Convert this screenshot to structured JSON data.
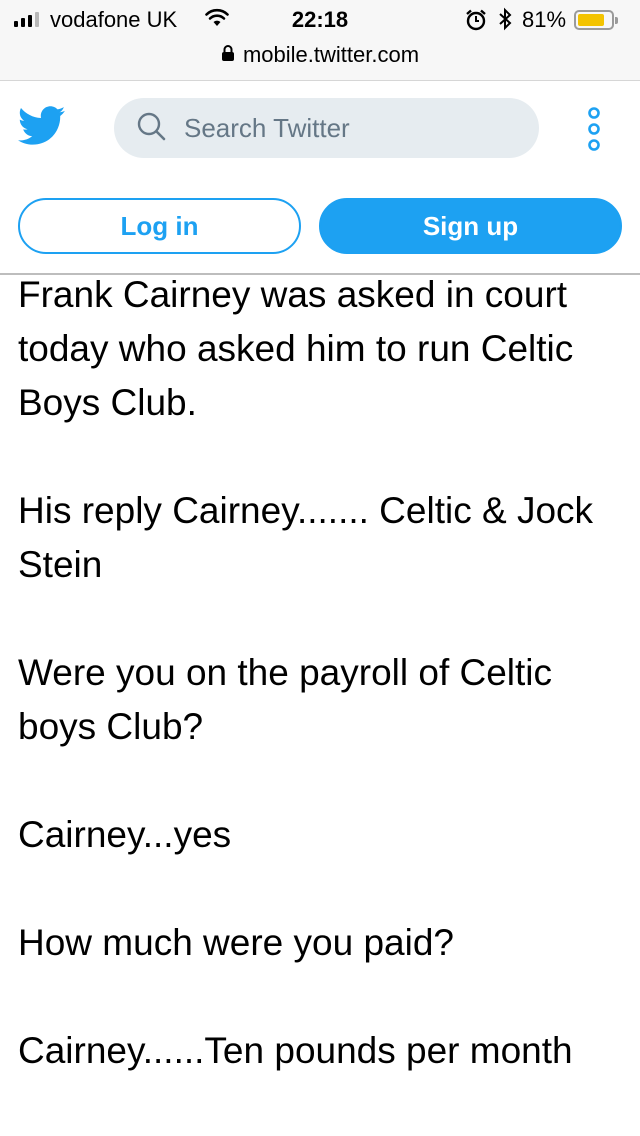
{
  "status_bar": {
    "carrier": "vodafone UK",
    "time": "22:18",
    "battery_percent": "81%",
    "battery_level": 0.81,
    "icons": [
      "signal-icon",
      "wifi-icon",
      "alarm-icon",
      "bluetooth-icon",
      "battery-icon"
    ]
  },
  "browser": {
    "url": "mobile.twitter.com",
    "icon": "lock-icon"
  },
  "header": {
    "logo": "twitter-bird-icon",
    "search_placeholder": "Search Twitter",
    "more_icon": "more-vertical-icon",
    "login_label": "Log in",
    "signup_label": "Sign up"
  },
  "colors": {
    "brand": "#1da1f2",
    "search_bg": "#e6ecf0",
    "battery": "#f3c300"
  },
  "tweet": {
    "paragraphs": [
      "Frank Cairney was asked in court today who asked him to run Celtic Boys Club.",
      "His reply Cairney....... Celtic & Jock Stein",
      "Were you on the payroll of Celtic boys Club?",
      "Cairney...yes",
      "How much were you paid?",
      "Cairney......Ten pounds per month"
    ]
  }
}
